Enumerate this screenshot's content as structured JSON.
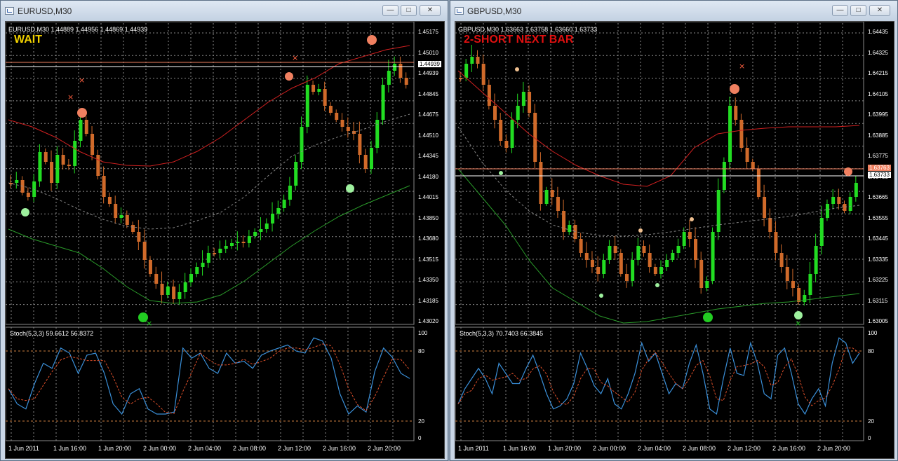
{
  "windows": [
    {
      "title": "EURUSD,M30",
      "header": "EURUSD,M30  1.44889 1.44956 1.44869 1.44939",
      "signal": "WAIT",
      "signal_color": "#f0d000",
      "price_labels": [
        "1.45175",
        "1.45010",
        "1.44939",
        "1.44845",
        "1.44675",
        "1.44510",
        "1.44345",
        "1.44180",
        "1.44015",
        "1.43850",
        "1.43680",
        "1.43515",
        "1.43350",
        "1.43185",
        "1.43020"
      ],
      "current_price": "1.44939",
      "indicator_label": "Stoch(5,3,3) 59.6612 56.8372",
      "stoch_levels": [
        "100",
        "80",
        "20",
        "0"
      ],
      "time_labels": [
        "1 Jun 2011",
        "1 Jun 16:00",
        "1 Jun 20:00",
        "2 Jun 00:00",
        "2 Jun 04:00",
        "2 Jun 08:00",
        "2 Jun 12:00",
        "2 Jun 16:00",
        "2 Jun 20:00"
      ]
    },
    {
      "title": "GBPUSD,M30",
      "header": "GBPUSD,M30  1.63663 1.63758 1.63660 1.63733",
      "signal": "2-SHORT NEXT BAR",
      "signal_color": "#e01010",
      "price_labels": [
        "1.64435",
        "1.64325",
        "1.64215",
        "1.64105",
        "1.63995",
        "1.63885",
        "1.63775",
        "1.63733",
        "1.63665",
        "1.63555",
        "1.63445",
        "1.63335",
        "1.63225",
        "1.63115",
        "1.63005"
      ],
      "current_price": "1.63733",
      "current_price_red": "1.63763",
      "indicator_label": "Stoch(5,3,3) 70.7403 66.3845",
      "stoch_levels": [
        "100",
        "80",
        "20",
        "0"
      ],
      "time_labels": [
        "1 Jun 2011",
        "1 Jun 16:00",
        "1 Jun 20:00",
        "2 Jun 00:00",
        "2 Jun 04:00",
        "2 Jun 08:00",
        "2 Jun 12:00",
        "2 Jun 16:00",
        "2 Jun 20:00"
      ]
    }
  ],
  "colors": {
    "bull": "#22dd22",
    "bear": "#d06a2a",
    "grid": "#8a8a8a",
    "upper_band": "#d02020",
    "lower_band": "#2a9a2a",
    "stoch_main": "#3a8fd8",
    "stoch_signal": "#e0502a"
  }
}
